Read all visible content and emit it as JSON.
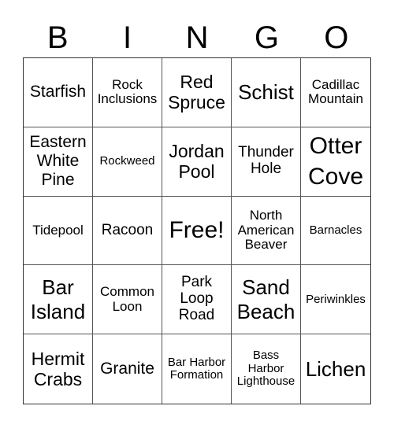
{
  "header": [
    "B",
    "I",
    "N",
    "G",
    "O"
  ],
  "cells": [
    [
      "Starfish",
      "Rock Inclusions",
      "Red Spruce",
      "Schist",
      "Cadillac Mountain"
    ],
    [
      "Eastern White Pine",
      "Rockweed",
      "Jordan Pool",
      "Thunder Hole",
      "Otter Cove"
    ],
    [
      "Tidepool",
      "Racoon",
      "Free!",
      "North American Beaver",
      "Barnacles"
    ],
    [
      "Bar Island",
      "Common Loon",
      "Park Loop Road",
      "Sand Beach",
      "Periwinkles"
    ],
    [
      "Hermit Crabs",
      "Granite",
      "Bar Harbor Formation",
      "Bass Harbor Lighthouse",
      "Lichen"
    ]
  ]
}
